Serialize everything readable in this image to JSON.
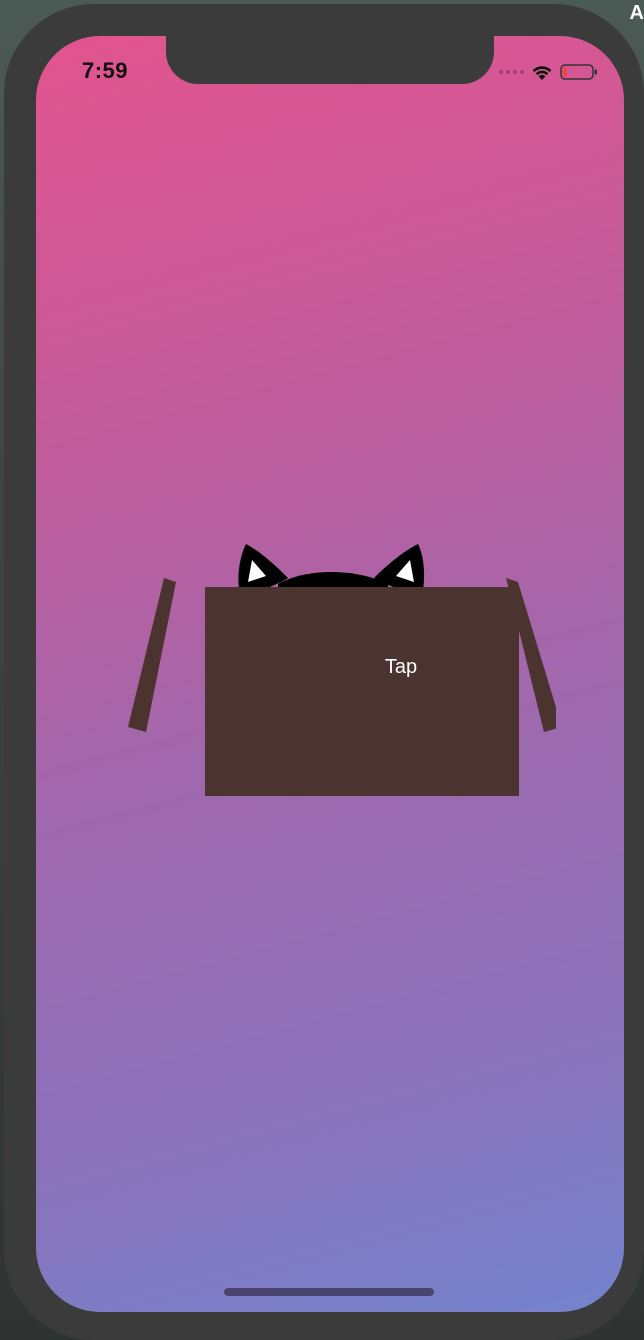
{
  "desktop": {
    "corner_text": "A"
  },
  "status_bar": {
    "time": "7:59",
    "wifi_icon": "wifi-icon",
    "battery_icon": "battery-low-icon",
    "signal_icon": "signal-dots-icon"
  },
  "scene": {
    "box_label": "Tap",
    "box_color": "#4b342f",
    "cat_color": "#000000"
  },
  "colors": {
    "gradient_top": "#e2548e",
    "gradient_bottom": "#7483cd",
    "battery_low": "#ff3b30"
  }
}
